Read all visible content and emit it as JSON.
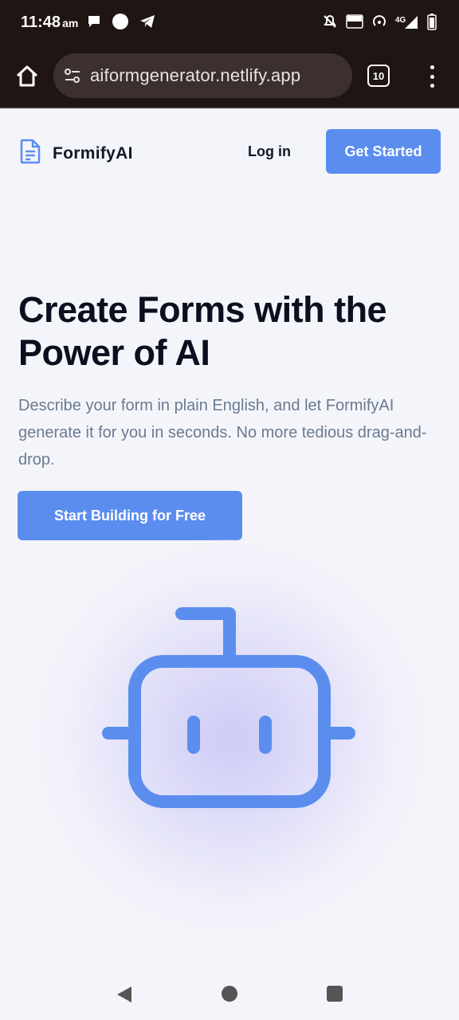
{
  "status_bar": {
    "time": "11:48",
    "ampm": "am",
    "icons": [
      "chat-bubble-icon",
      "circle-icon",
      "telegram-icon",
      "mute-icon",
      "volte-icon",
      "hotspot-icon",
      "signal-4g-icon",
      "battery-icon"
    ],
    "network_label": "4G",
    "volte_label": "VO LTE"
  },
  "browser": {
    "url": "aiformgenerator.netlify.app",
    "tab_count": "10"
  },
  "header": {
    "brand": "FormifyAI",
    "login_label": "Log in",
    "get_started_label": "Get Started"
  },
  "hero": {
    "title": "Create Forms with the Power of AI",
    "subtitle": "Describe your form in plain English, and let FormifyAI generate it for you in seconds. No more tedious drag-and-drop.",
    "cta_label": "Start Building for Free"
  },
  "colors": {
    "accent": "#5b8def",
    "status_bg": "#1f1512",
    "page_bg": "#f4f5fa",
    "heading": "#0b1020",
    "subtext": "#6b7a90"
  },
  "nav": {
    "icons": [
      "back-icon",
      "home-icon",
      "recents-icon"
    ]
  }
}
